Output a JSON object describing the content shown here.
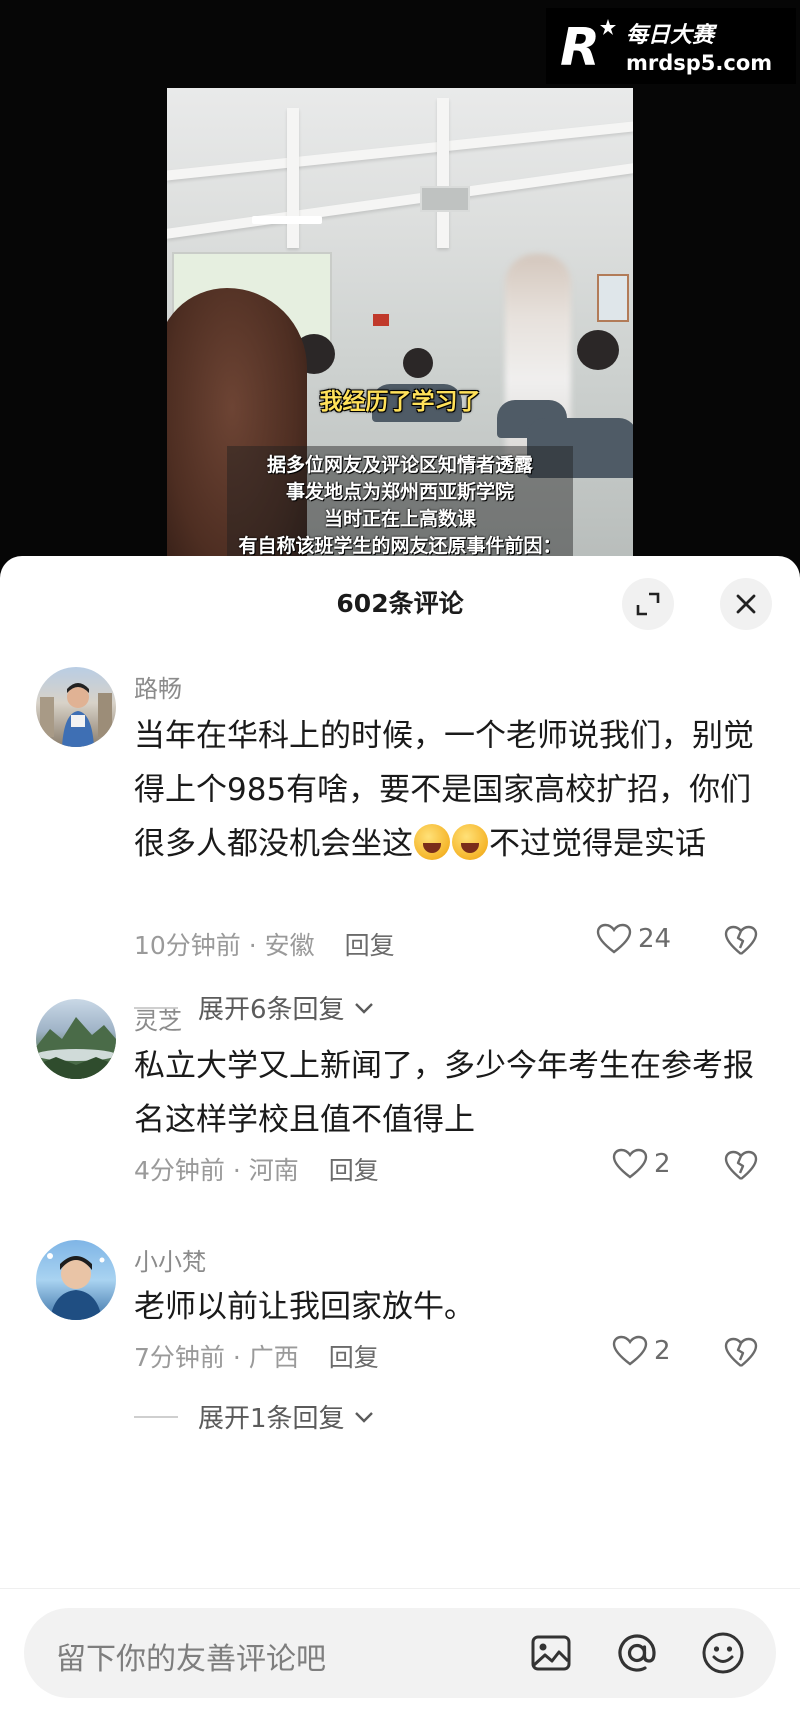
{
  "video": {
    "caption_main": "我经历了学习了",
    "subtitles": [
      "据多位网友及评论区知情者透露",
      "事发地点为郑州西亚斯学院",
      "当时正在上高数课",
      "有自称该班学生的网友还原事件前因："
    ]
  },
  "watermark": {
    "title": "每日大赛",
    "url": "mrdsp5.com",
    "logo_letter": "R"
  },
  "sheet": {
    "title": "602条评论"
  },
  "comments": [
    {
      "user": "路畅",
      "text_before_emoji": "当年在华科上的时候，一个老师说我们，别觉得上个985有啥，要不是国家高校扩招，你们很多人都没机会坐这",
      "text_after_emoji": "不过觉得是实话",
      "meta": "10分钟前 · 安徽",
      "reply_label": "回复",
      "likes": "24",
      "expand_label": "展开6条回复"
    },
    {
      "user": "灵芝",
      "text": "私立大学又上新闻了，多少今年考生在参考报名这样学校且值不值得上",
      "meta": "4分钟前 · 河南",
      "reply_label": "回复",
      "likes": "2"
    },
    {
      "user": "小小梵",
      "text": "老师以前让我回家放牛。",
      "meta": "7分钟前 · 广西",
      "reply_label": "回复",
      "likes": "2",
      "expand_label": "展开1条回复"
    }
  ],
  "input": {
    "placeholder": "留下你的友善评论吧"
  },
  "icons": {
    "expand": "expand-icon",
    "close": "close-icon",
    "like": "heart-outline-icon",
    "dislike": "broken-heart-icon",
    "image": "image-icon",
    "mention": "at-icon",
    "emoji": "smiley-icon"
  }
}
